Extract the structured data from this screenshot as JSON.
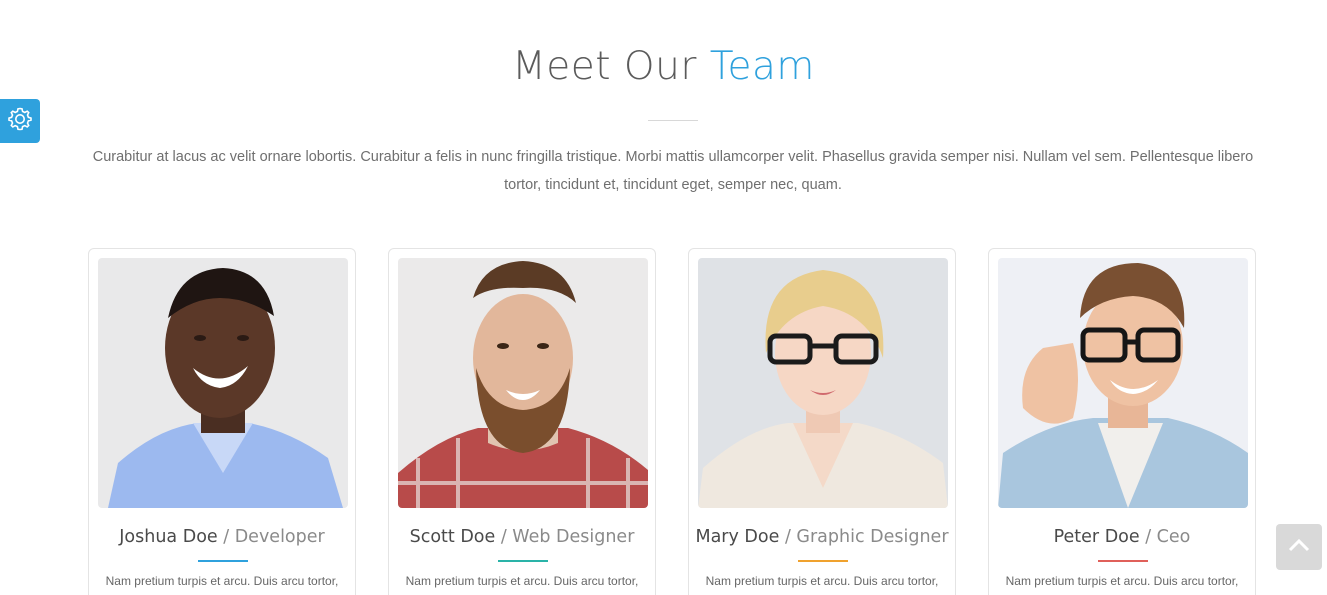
{
  "section": {
    "title_main": "Meet Our ",
    "title_accent": "Team",
    "intro": "Curabitur at lacus ac velit ornare lobortis. Curabitur a felis in nunc fringilla tristique. Morbi mattis ullamcorper velit. Phasellus gravida semper nisi. Nullam vel sem. Pellentesque libero tortor, tincidunt et, tincidunt eget, semper nec, quam."
  },
  "team": [
    {
      "name": "Joshua Doe",
      "separator": " / ",
      "role": "Developer",
      "bio": "Nam pretium turpis et arcu. Duis arcu tortor,",
      "accent_color": "#2fa1dd"
    },
    {
      "name": "Scott Doe",
      "separator": " / ",
      "role": "Web Designer",
      "bio": "Nam pretium turpis et arcu. Duis arcu tortor,",
      "accent_color": "#2ab3a8"
    },
    {
      "name": "Mary Doe",
      "separator": " / ",
      "role": "Graphic Designer",
      "bio": "Nam pretium turpis et arcu. Duis arcu tortor,",
      "accent_color": "#f0a22e"
    },
    {
      "name": "Peter Doe",
      "separator": " / ",
      "role": "Ceo",
      "bio": "Nam pretium turpis et arcu. Duis arcu tortor,",
      "accent_color": "#e0605a"
    }
  ],
  "icons": {
    "settings": "gear-icon",
    "back_to_top": "chevron-up-icon"
  },
  "colors": {
    "accent": "#2fa1dd",
    "back_to_top_bg": "#d9d9d9"
  }
}
